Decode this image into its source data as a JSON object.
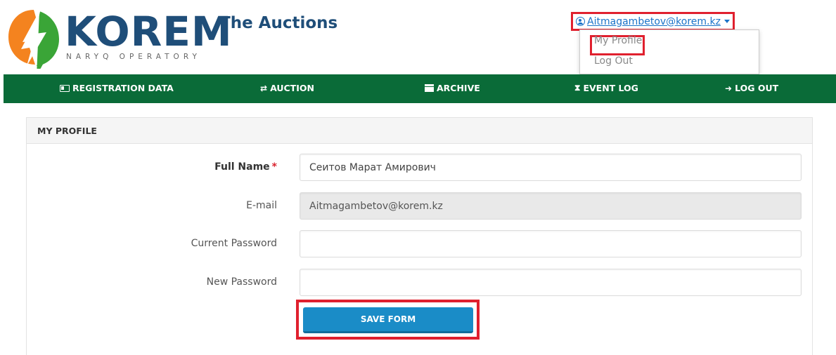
{
  "brand": {
    "name": "KOREM",
    "tagline": "NARYQ OPERATORY",
    "colors": {
      "primary": "#1f4e79",
      "nav": "#0a6b38",
      "accent_orange": "#f4831f",
      "accent_green": "#3aa537"
    }
  },
  "header": {
    "app_title": "The Auctions",
    "user_email": "Aitmagambetov@korem.kz",
    "user_icon": "user-circle-icon"
  },
  "user_dropdown": {
    "items": [
      {
        "label": "My Profile"
      },
      {
        "label": "Log Out"
      }
    ]
  },
  "nav": {
    "items": [
      {
        "label": "REGISTRATION DATA",
        "icon": "id-card-icon"
      },
      {
        "label": "AUCTION",
        "icon": "exchange-arrows-icon"
      },
      {
        "label": "ARCHIVE",
        "icon": "archive-box-icon"
      },
      {
        "label": "EVENT LOG",
        "icon": "hourglass-icon"
      },
      {
        "label": "LOG OUT",
        "icon": "sign-out-icon"
      }
    ]
  },
  "profile_form": {
    "heading": "MY PROFILE",
    "full_name_label": "Full Name",
    "required_mark": "*",
    "full_name_value": "Сеитов Марат Амирович",
    "email_label": "E-mail",
    "email_value": "Aitmagambetov@korem.kz",
    "current_password_label": "Current Password",
    "current_password_value": "",
    "new_password_label": "New Password",
    "new_password_value": "",
    "save_label": "SAVE FORM"
  },
  "highlights": {
    "color": "#e0202e"
  }
}
